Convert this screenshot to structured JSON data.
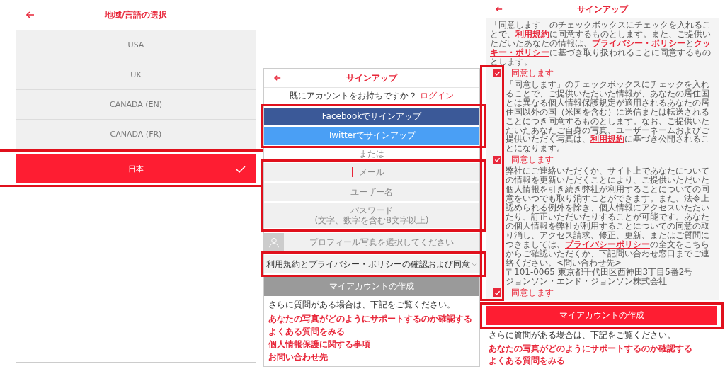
{
  "region_screen": {
    "title": "地域/言語の選択",
    "options": [
      {
        "label": "USA",
        "selected": false
      },
      {
        "label": "UK",
        "selected": false
      },
      {
        "label": "CANADA (EN)",
        "selected": false
      },
      {
        "label": "CANADA (FR)",
        "selected": false
      },
      {
        "label": "日本",
        "selected": true
      }
    ]
  },
  "signup_screen": {
    "title": "サインアップ",
    "login_prompt": "既にアカウントをお持ちですか？",
    "login_link": "ログイン",
    "social_buttons": [
      {
        "kind": "facebook",
        "label": "Facebookでサインアップ"
      },
      {
        "kind": "twitter",
        "label": "Twitterでサインアップ"
      }
    ],
    "divider": "または",
    "fields": [
      {
        "placeholder": "メール",
        "focused": true
      },
      {
        "placeholder": "ユーザー名",
        "focused": false
      },
      {
        "placeholder": "パスワード",
        "hint": "(文字、数字を含む8文字以上)",
        "focused": false
      }
    ],
    "profile_photo": "プロフィール写真を選択してください",
    "consent_section": {
      "label": "利用規約とプライバシー・ポリシーの確認および同意",
      "expanded": false
    },
    "create_button": {
      "label": "マイアカウントの作成",
      "disabled": true
    },
    "help_text": "さらに質問がある場合は、下記をご覧ください。",
    "links": [
      "あなたの写真がどのようにサポートするのか確認する",
      "よくある質問をみる",
      "個人情報保護に関する事項",
      "お問い合わせ先"
    ]
  },
  "consent_screen": {
    "title": "サインアップ",
    "sections": [
      {
        "text": "「同意します」のチェックボックスにチェックを入れることで、**利用規約**に同意するものとします。また、ご提供いただいたあなたの情報は、**プライバシー・ポリシー**と**クッキー・ポリシー**に基づき取り扱われることに同意するものとします。",
        "checkbox": "同意します",
        "checked": true
      },
      {
        "text": "「同意します」のチェックボックスにチェックを入れることで、ご提供いただいた情報が、あなたの居住国とは異なる個人情報保護規定が適用されるあなたの居住国以外の国（米国を含む）に送信または転送されることにつき同意するものとします。なお、ご提供いただいたあなたご自身の写真、ユーザーネームおよびご提供いただく写真は、**利用規約**に基づき公開されることになります。",
        "checkbox": "同意します",
        "checked": true
      },
      {
        "text": "弊社にご連絡いただくか、サイト上であなたについての情報を更新いただくことにより、ご提供いただいた個人情報を引き続き弊社が利用することについての同意をいつでも取り消すことができます。また、法令上認められる例外を除き、個人情報にアクセスいただいたり、訂正いただいたりすることが可能です。あなたの個人情報を弊社が利用することについての同意の取り消し、アクセス請求、修正、更新、またはご質問につきましては、**プライバシーポリシー**の全文をこちらからご確認いただくか、下記問い合わせ窓口までご連絡ください。<問い合わせ先>",
        "address": [
          "〒101-0065 東京都千代田区西神田3丁目5番2号",
          "ジョンソン・エンド・ジョンソン株式会社"
        ],
        "checkbox": "同意します",
        "checked": true
      }
    ],
    "create_button": {
      "label": "マイアカウントの作成",
      "disabled": false
    },
    "help_text": "さらに質問がある場合は、下記をご覧ください。",
    "links": [
      "あなたの写真がどのようにサポートするのか確認する",
      "よくある質問をみる"
    ]
  }
}
